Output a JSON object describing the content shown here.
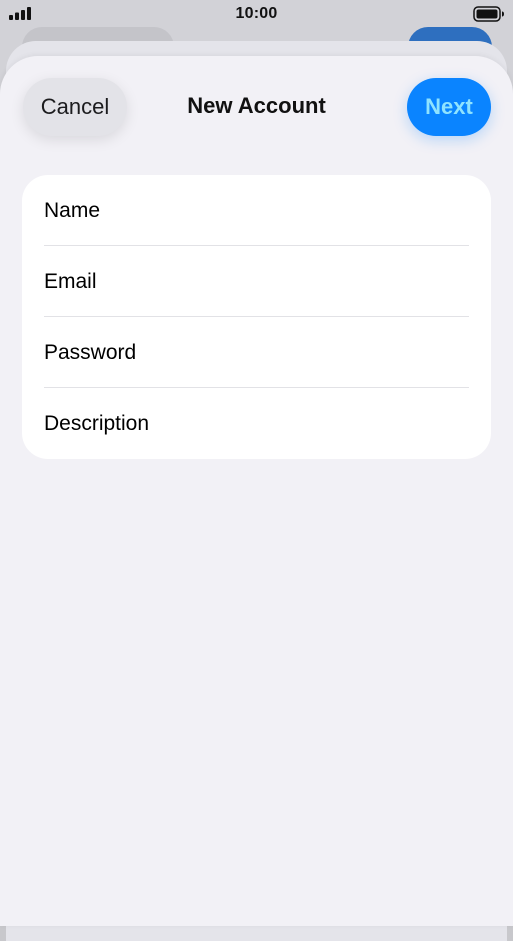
{
  "status_bar": {
    "time": "10:00",
    "signal_icon": "cellular-signal-icon",
    "battery_icon": "battery-full-icon"
  },
  "nav": {
    "cancel_label": "Cancel",
    "title": "New Account",
    "next_label": "Next"
  },
  "form": {
    "fields": [
      {
        "placeholder": "Name",
        "value": ""
      },
      {
        "placeholder": "Email",
        "value": ""
      },
      {
        "placeholder": "Password",
        "value": ""
      },
      {
        "placeholder": "Description",
        "value": ""
      }
    ]
  },
  "colors": {
    "accent": "#0a84ff",
    "next_text": "#8fe3ff",
    "sheet_background": "#f2f1f6",
    "card_background": "#ffffff"
  }
}
